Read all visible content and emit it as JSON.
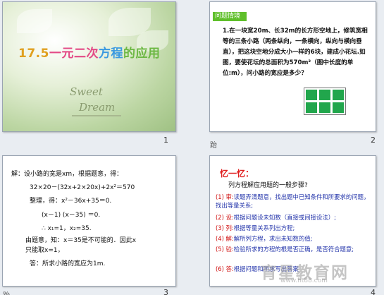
{
  "slides": [
    {
      "number": "1",
      "title_parts": [
        "17.5",
        "一元二次",
        "方程",
        "的应用"
      ],
      "script_line1": "Sweet",
      "script_line2": "Dream"
    },
    {
      "number": "2",
      "tag": "问题情境",
      "problem": "1.在一块宽20m、长32m的长方形空地上，修筑宽相等的三条小路（两条纵向，一条横向，纵向与横向垂直），把这块空地分成大小一样的6块，建成小花坛.如图，要使花坛的总面积为570m²（图中长度的单位:m），问小路的宽应是多少？",
      "note": "跆"
    },
    {
      "number": "3",
      "lines": [
        "解：设小路的宽是xm，根据题意，得：",
        "32×20－(32x+2×20x)+2x²＝570",
        "整理，得：x²－36x+35＝0.",
        "(x－1) (x－35) ＝0.",
        "∴ x₁=1，x₂=35.",
        "由题意，知：x＝35是不可能的．因此x",
        "只能取x=1，",
        "答：所求小路的宽应为1m."
      ],
      "note": "跆"
    },
    {
      "number": "4",
      "heading": "忆一忆：",
      "subheading": "列方程解应用题的一般步骤?",
      "steps": [
        {
          "key": "(1) 审:",
          "text": "读题弄清题意，找出题中已知条件和所要求的问题，找出等量关系;"
        },
        {
          "key": "(2) 设:",
          "text": "根据问题设未知数（直接或间接设法）;"
        },
        {
          "key": "(3) 列:",
          "text": "根据等量关系列出方程;"
        },
        {
          "key": "(4) 解:",
          "text": "解所列方程，求出未知数的值;"
        },
        {
          "key": "(5) 验:",
          "text": "检验所求的方程的根是否正确，是否符合题意;"
        },
        {
          "key": "(6) 答:",
          "text": "根据问题和所求写出答案"
        }
      ],
      "watermark": "育星教育网",
      "watermark_url": "www.ht88.com"
    }
  ]
}
